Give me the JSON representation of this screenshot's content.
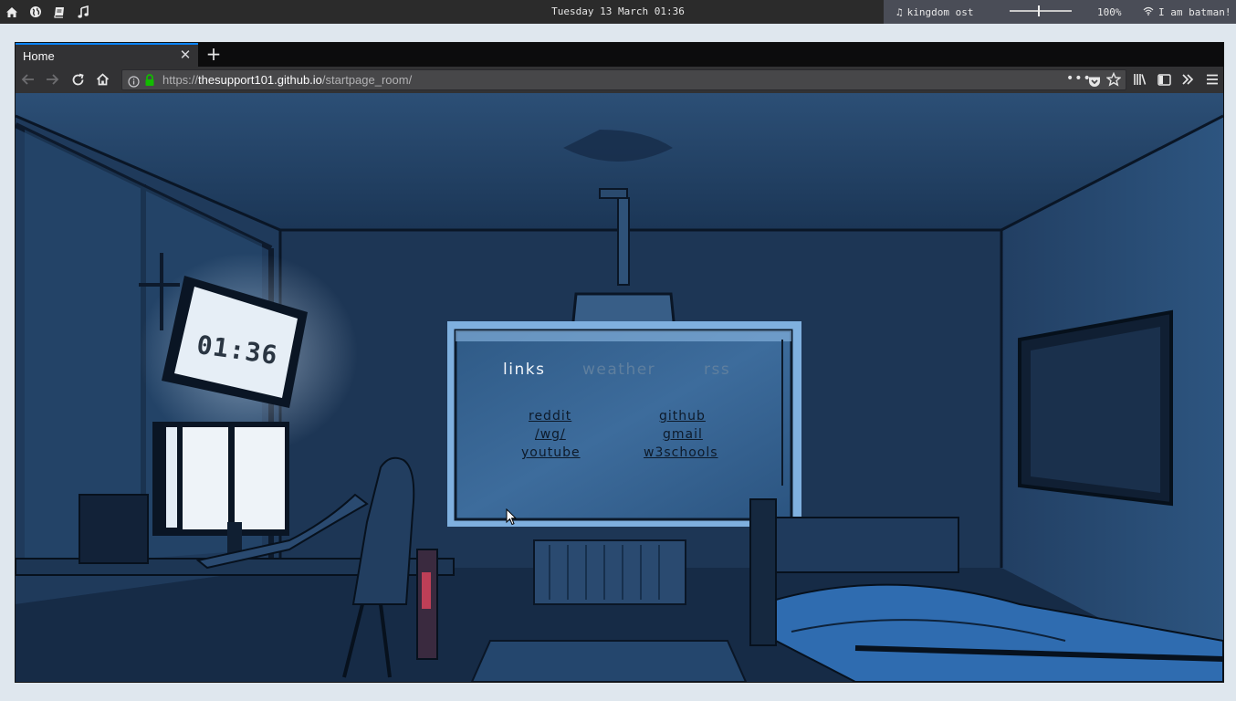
{
  "taskbar": {
    "datetime": "Tuesday 13 March 01:36",
    "now_playing": "kingdom ost",
    "volume": "100%",
    "wifi_name": "I am batman!",
    "volume_level": 0.45,
    "workspace_icons": [
      "home-icon",
      "globe-icon",
      "book-icon",
      "music-icon"
    ]
  },
  "browser": {
    "tab_title": "Home",
    "url_protocol": "https://",
    "url_domain": "thesupport101.github.io",
    "url_path": "/startpage_room/"
  },
  "startpage": {
    "clock": "01:36",
    "menu": [
      {
        "label": "links",
        "active": true
      },
      {
        "label": "weather",
        "active": false
      },
      {
        "label": "rss",
        "active": false
      }
    ],
    "links_left": [
      "reddit",
      "/wg/",
      "youtube"
    ],
    "links_right": [
      "github",
      "gmail",
      "w3schools"
    ]
  },
  "colors": {
    "accent_tab": "#0a84ff",
    "lock_green": "#12bc00",
    "room_blue": "#1f3a5c"
  }
}
